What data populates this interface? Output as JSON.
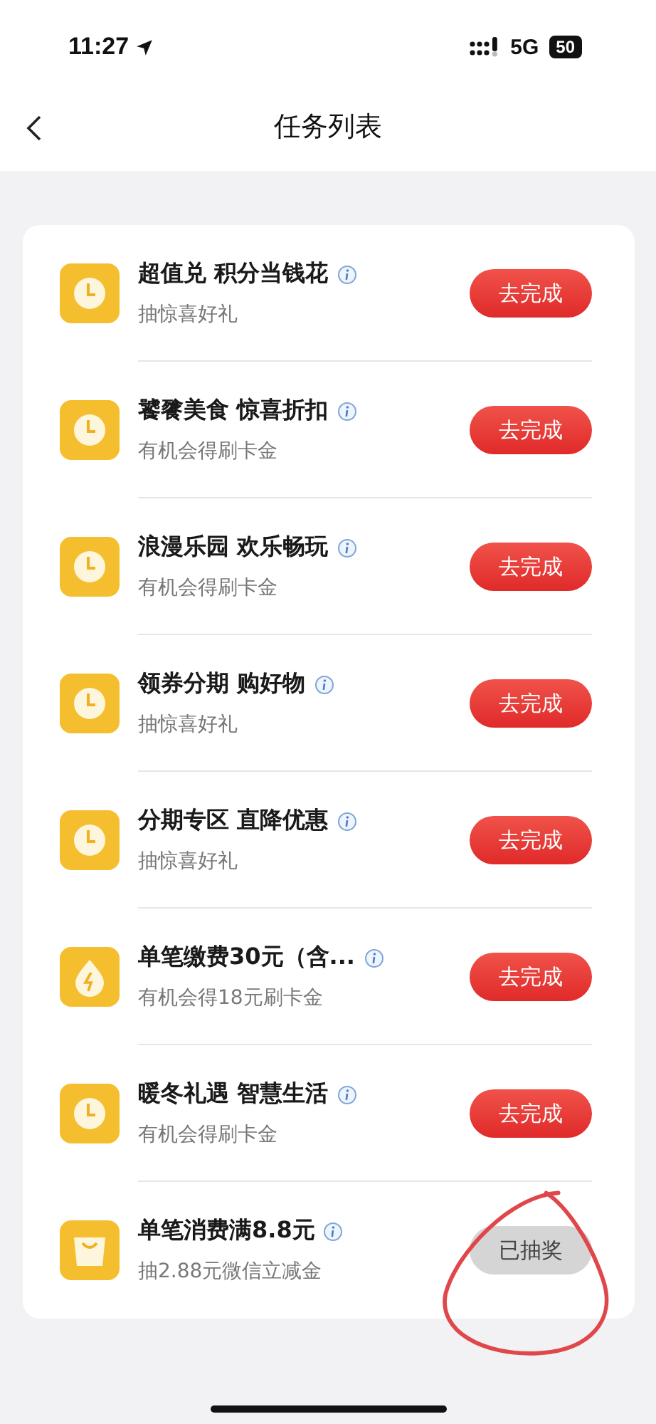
{
  "status_bar": {
    "time": "11:27",
    "network": "5G",
    "battery": "50"
  },
  "nav": {
    "title": "任务列表"
  },
  "tasks": [
    {
      "kind": "clock",
      "title": "超值兑 积分当钱花",
      "subtitle": "抽惊喜好礼",
      "action": "去完成",
      "completed": false
    },
    {
      "kind": "clock",
      "title": "饕餮美食 惊喜折扣",
      "subtitle": "有机会得刷卡金",
      "action": "去完成",
      "completed": false
    },
    {
      "kind": "clock",
      "title": "浪漫乐园 欢乐畅玩",
      "subtitle": "有机会得刷卡金",
      "action": "去完成",
      "completed": false
    },
    {
      "kind": "clock",
      "title": "领券分期 购好物",
      "subtitle": "抽惊喜好礼",
      "action": "去完成",
      "completed": false
    },
    {
      "kind": "clock",
      "title": "分期专区 直降优惠",
      "subtitle": "抽惊喜好礼",
      "action": "去完成",
      "completed": false
    },
    {
      "kind": "drop",
      "title": "单笔缴费30元（含...",
      "subtitle": "有机会得18元刷卡金",
      "action": "去完成",
      "completed": false
    },
    {
      "kind": "clock",
      "title": "暖冬礼遇 智慧生活",
      "subtitle": "有机会得刷卡金",
      "action": "去完成",
      "completed": false
    },
    {
      "kind": "bag",
      "title": "单笔消费满8.8元",
      "subtitle": "抽2.88元微信立减金",
      "action": "已抽奖",
      "completed": true
    }
  ]
}
